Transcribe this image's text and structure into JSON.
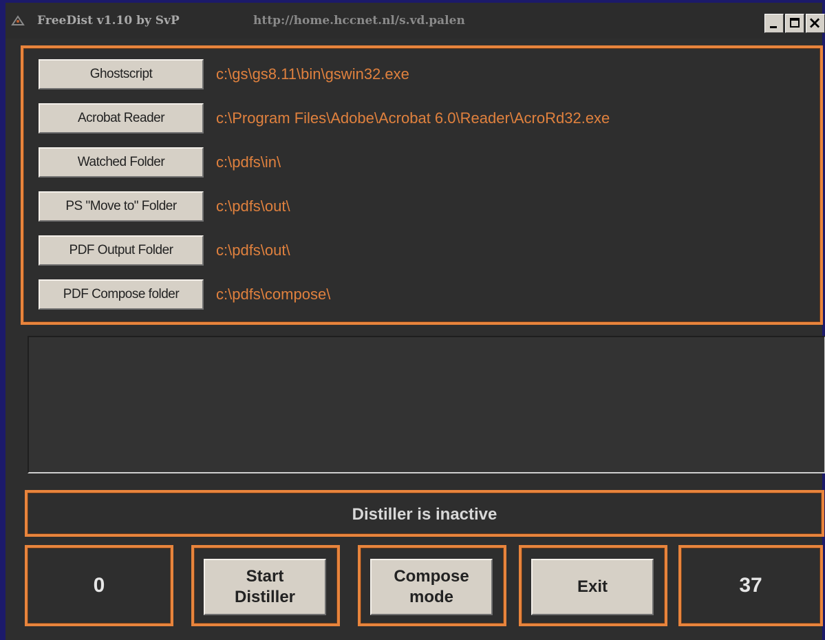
{
  "window": {
    "title": "FreeDist v1.10 by SvP",
    "url": "http://home.hccnet.nl/s.vd.palen",
    "minimize_icon": "minimize-icon",
    "maximize_icon": "maximize-icon",
    "close_icon": "close-icon"
  },
  "paths": [
    {
      "label": "Ghostscript",
      "value": "c:\\gs\\gs8.11\\bin\\gswin32.exe"
    },
    {
      "label": "Acrobat Reader",
      "value": "c:\\Program Files\\Adobe\\Acrobat 6.0\\Reader\\AcroRd32.exe"
    },
    {
      "label": "Watched Folder",
      "value": "c:\\pdfs\\in\\"
    },
    {
      "label": "PS \"Move to\" Folder",
      "value": "c:\\pdfs\\out\\"
    },
    {
      "label": "PDF Output Folder",
      "value": "c:\\pdfs\\out\\"
    },
    {
      "label": "PDF Compose folder",
      "value": "c:\\pdfs\\compose\\"
    }
  ],
  "log": "",
  "status": "Distiller is inactive",
  "bottom": {
    "left_counter": "0",
    "start_label": "Start\nDistiller",
    "compose_label": "Compose\nmode",
    "exit_label": "Exit",
    "right_counter": "37"
  },
  "colors": {
    "accent": "#e8843c",
    "path_text": "#e0813e",
    "background": "#2e2e2e",
    "button_face": "#d6d0c6"
  }
}
